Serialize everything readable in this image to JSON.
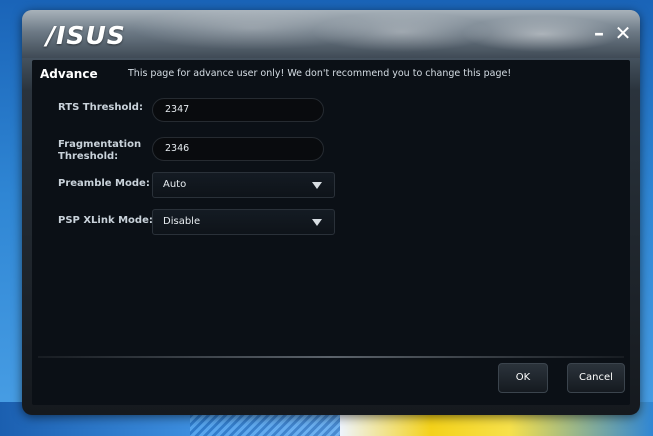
{
  "window": {
    "logo": "/ISUS",
    "minimize_label": "–",
    "close_label": "✕"
  },
  "header": {
    "title": "Advance",
    "note": "This page for advance user only! We don't recommend you to change this page!"
  },
  "form": {
    "rts_label": "RTS Threshold:",
    "rts_value": "2347",
    "frag_label_1": "Fragmentation",
    "frag_label_2": "Threshold:",
    "frag_value": "2346",
    "preamble_label": "Preamble Mode:",
    "preamble_value": "Auto",
    "psp_label": "PSP XLink Mode:",
    "psp_value": "Disable"
  },
  "footer": {
    "ok_label": "OK",
    "cancel_label": "Cancel"
  },
  "icons": {
    "dropdown_arrow": "chevron-down-icon"
  }
}
